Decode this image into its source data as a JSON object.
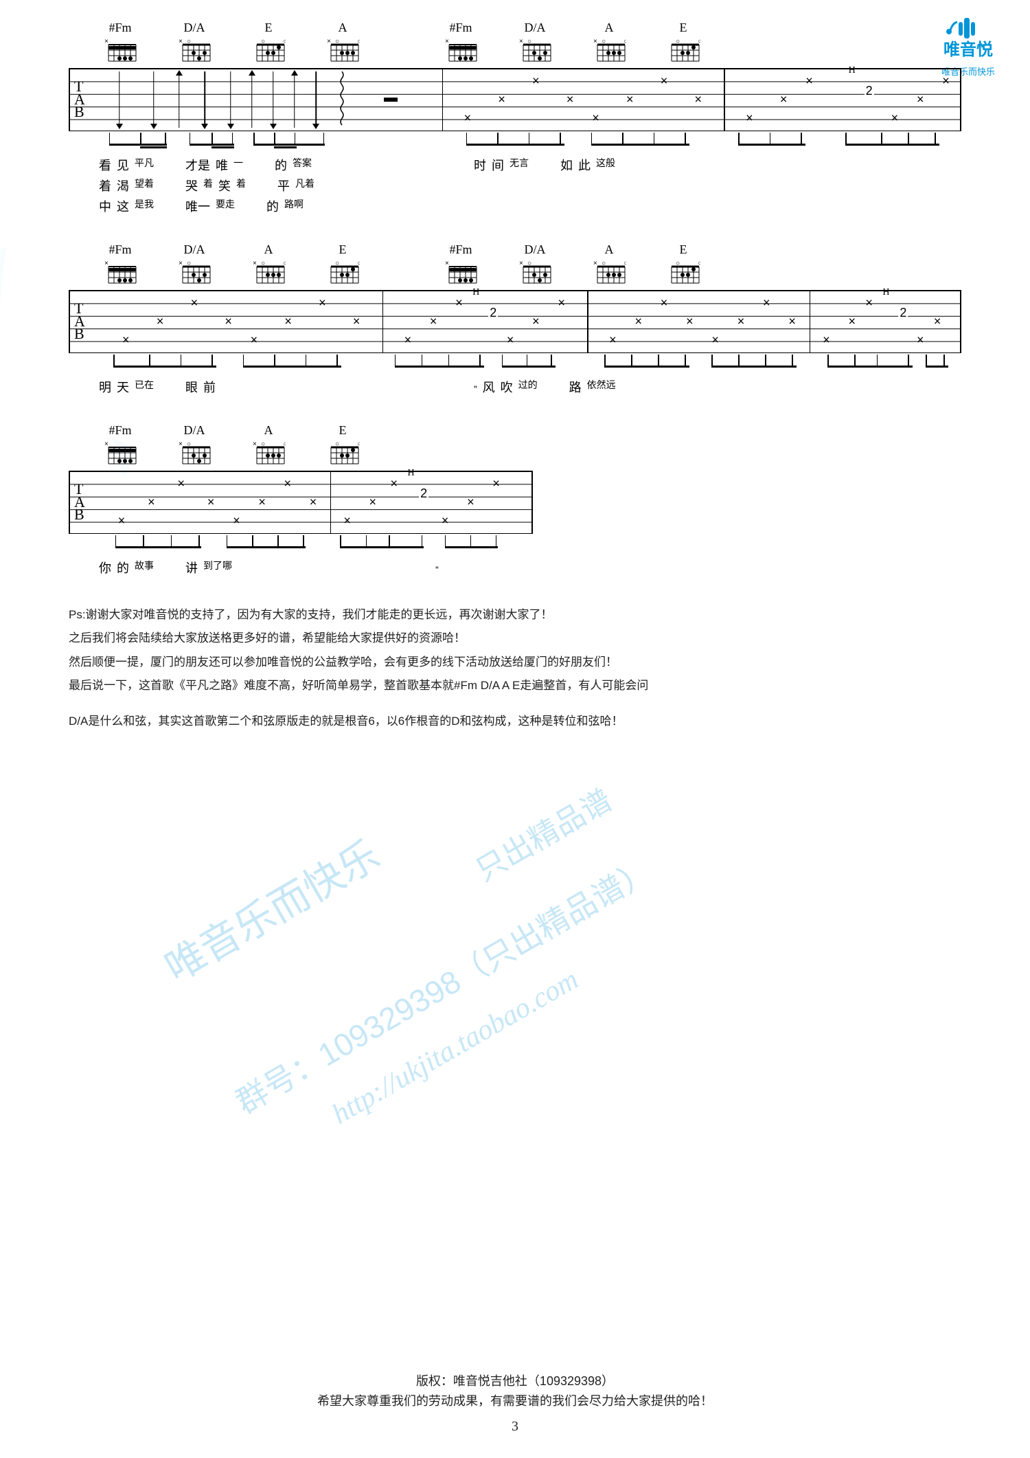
{
  "logo": {
    "tagline": "唯音乐而快乐"
  },
  "systems": [
    {
      "chords_left": [
        "#Fm",
        "D/A",
        "E",
        "A"
      ],
      "chords_right": [
        "#Fm",
        "D/A",
        "A",
        "E"
      ],
      "lyrics": [
        [
          {
            "t": "看",
            "cls": ""
          },
          {
            "t": "见",
            "cls": ""
          },
          {
            "t": "平凡",
            "cls": "sm"
          },
          {
            "t": "",
            "cls": "gap"
          },
          {
            "t": "才是",
            "cls": ""
          },
          {
            "t": "唯",
            "cls": ""
          },
          {
            "t": "一",
            "cls": "sm"
          },
          {
            "t": "",
            "cls": "gap"
          },
          {
            "t": "的",
            "cls": ""
          },
          {
            "t": "答案",
            "cls": "sm"
          },
          {
            "t": "",
            "cls": "gapL"
          },
          {
            "t": "时",
            "cls": ""
          },
          {
            "t": "间",
            "cls": ""
          },
          {
            "t": "无言",
            "cls": "sm"
          },
          {
            "t": "",
            "cls": "gap"
          },
          {
            "t": "如",
            "cls": ""
          },
          {
            "t": "此",
            "cls": ""
          },
          {
            "t": "这般",
            "cls": "sm"
          }
        ],
        [
          {
            "t": "着",
            "cls": ""
          },
          {
            "t": "渴",
            "cls": ""
          },
          {
            "t": "望着",
            "cls": "sm"
          },
          {
            "t": "",
            "cls": "gap"
          },
          {
            "t": "哭",
            "cls": ""
          },
          {
            "t": "着",
            "cls": "sm"
          },
          {
            "t": "笑",
            "cls": ""
          },
          {
            "t": "着",
            "cls": "sm"
          },
          {
            "t": "",
            "cls": "gap"
          },
          {
            "t": "平",
            "cls": ""
          },
          {
            "t": "凡着",
            "cls": "sm"
          }
        ],
        [
          {
            "t": "中",
            "cls": ""
          },
          {
            "t": "这",
            "cls": ""
          },
          {
            "t": "是我",
            "cls": "sm"
          },
          {
            "t": "",
            "cls": "gap"
          },
          {
            "t": "唯一",
            "cls": ""
          },
          {
            "t": "要走",
            "cls": "sm"
          },
          {
            "t": "",
            "cls": "gap"
          },
          {
            "t": "的",
            "cls": ""
          },
          {
            "t": "路啊",
            "cls": "sm"
          }
        ]
      ]
    },
    {
      "chords_left": [
        "#Fm",
        "D/A",
        "A",
        "E"
      ],
      "chords_right": [
        "#Fm",
        "D/A",
        "A",
        "E"
      ],
      "lyrics": [
        [
          {
            "t": "明",
            "cls": ""
          },
          {
            "t": "天",
            "cls": ""
          },
          {
            "t": "已在",
            "cls": "sm"
          },
          {
            "t": "",
            "cls": "gap"
          },
          {
            "t": "眼",
            "cls": ""
          },
          {
            "t": "前",
            "cls": ""
          },
          {
            "t": "",
            "cls": "gapXL"
          },
          {
            "t": "„",
            "cls": "sm"
          },
          {
            "t": "风",
            "cls": ""
          },
          {
            "t": "吹",
            "cls": ""
          },
          {
            "t": "过的",
            "cls": "sm"
          },
          {
            "t": "",
            "cls": "gap"
          },
          {
            "t": "路",
            "cls": ""
          },
          {
            "t": "依然远",
            "cls": "sm"
          }
        ]
      ]
    },
    {
      "chords_left": [
        "#Fm",
        "D/A",
        "A",
        "E"
      ],
      "chords_right": [],
      "lyrics": [
        [
          {
            "t": "你",
            "cls": ""
          },
          {
            "t": "的",
            "cls": ""
          },
          {
            "t": "故事",
            "cls": "sm"
          },
          {
            "t": "",
            "cls": "gap"
          },
          {
            "t": "讲",
            "cls": ""
          },
          {
            "t": "到了哪",
            "cls": "sm"
          },
          {
            "t": "",
            "cls": "gapXXL"
          },
          {
            "t": "„",
            "cls": "sm"
          }
        ]
      ]
    }
  ],
  "notes": [
    "Ps:谢谢大家对唯音悦的支持了，因为有大家的支持，我们才能走的更长远，再次谢谢大家了！",
    "之后我们将会陆续给大家放送格更多好的谱，希望能给大家提供好的资源哈！",
    "然后顺便一提，厦门的朋友还可以参加唯音悦的公益教学哈，会有更多的线下活动放送给厦门的好朋友们！",
    "最后说一下，这首歌《平凡之路》难度不高，好听简单易学，整首歌基本就#Fm D/A A E走遍整首，有人可能会问",
    "",
    "D/A是什么和弦，其实这首歌第二个和弦原版走的就是根音6，以6作根音的D和弦构成，这种是转位和弦哈！"
  ],
  "watermarks": {
    "wm3": "唯音乐而快乐",
    "wm4": "群号：109329398（只出精品谱）",
    "wm5": "http://ukjita.taobao.com"
  },
  "footer": {
    "line1": "版权：唯音悦吉他社（109329398）",
    "line2": "希望大家尊重我们的劳动成果，有需要谱的我们会尽力给大家提供的哈！",
    "page": "3"
  }
}
